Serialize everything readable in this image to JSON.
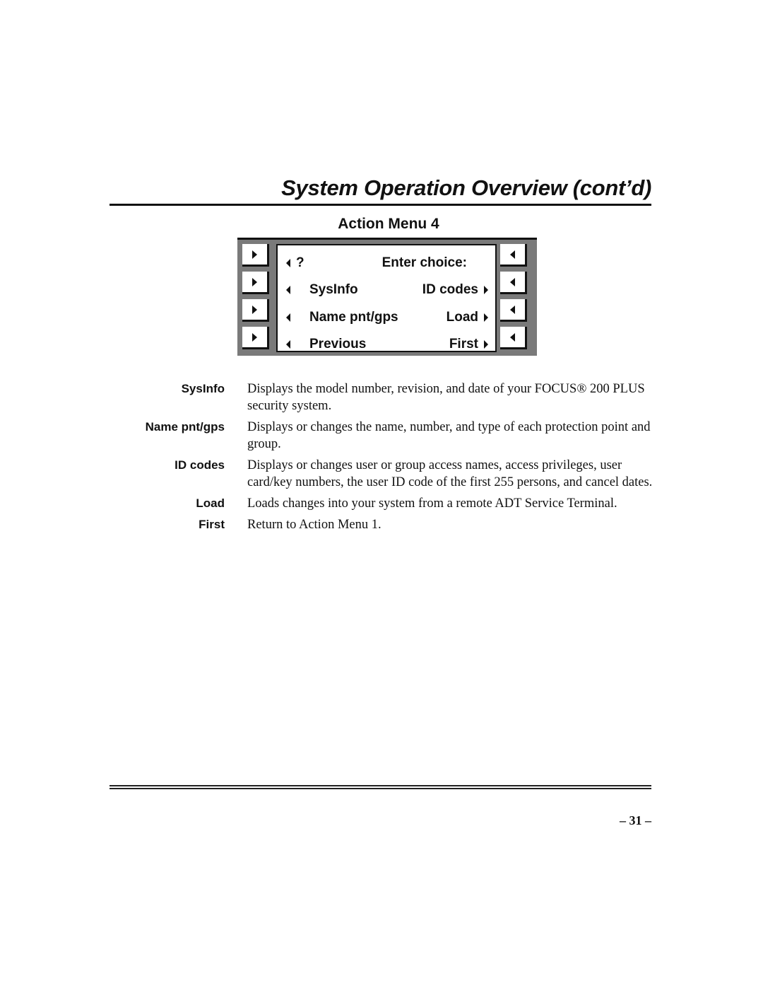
{
  "page": {
    "title": "System Operation Overview (cont’d)",
    "section_heading": "Action Menu 4",
    "page_number": "– 31 –"
  },
  "keypad": {
    "left_keys_icon": "triangle-right-icon",
    "right_keys_icon": "triangle-left-icon",
    "display": {
      "rows": [
        {
          "left_arrow": true,
          "left_text": "?",
          "right_text": "Enter choice:",
          "right_arrow": false
        },
        {
          "left_arrow": true,
          "left_text": "SysInfo",
          "right_text": "ID codes",
          "right_arrow": true
        },
        {
          "left_arrow": true,
          "left_text": "Name pnt/gps",
          "right_text": "Load",
          "right_arrow": true
        },
        {
          "left_arrow": true,
          "left_text": "Previous",
          "right_text": "First",
          "right_arrow": true
        }
      ]
    }
  },
  "definitions": [
    {
      "term": "SysInfo",
      "description": "Displays the model number, revision, and date of your FOCUS® 200 PLUS security system."
    },
    {
      "term": "Name pnt/gps",
      "description": "Displays or changes the name, number, and type of each protection point and group."
    },
    {
      "term": "ID codes",
      "description": "Displays or changes user or group access names, access privileges, user card/key numbers, the user ID code of the first 255 persons, and cancel dates."
    },
    {
      "term": "Load",
      "description": "Loads changes into your system from a remote ADT Service Terminal."
    },
    {
      "term": "First",
      "description": "Return to Action Menu 1."
    }
  ]
}
